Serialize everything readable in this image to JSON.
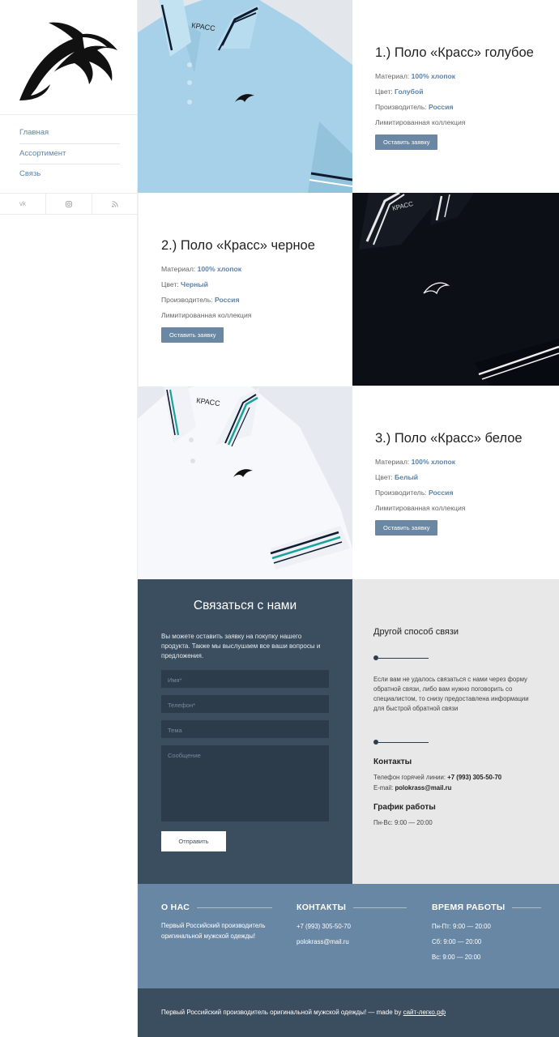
{
  "sidebar": {
    "nav": [
      "Главная",
      "Ассортимент",
      "Связь"
    ],
    "social": [
      "vk-icon",
      "instagram-icon",
      "rss-icon"
    ]
  },
  "products": [
    {
      "title": "1.) Поло «Красс» голубое",
      "material_label": "Материал:",
      "material": "100% хлопок",
      "color_label": "Цвет:",
      "color": "Голубой",
      "maker_label": "Производитель:",
      "maker": "Россия",
      "note": "Лимитированная коллекция",
      "button": "Оставить заявку",
      "shirt_color": "#a9d3ea",
      "collar_tag": "КРАСС"
    },
    {
      "title": "2.) Поло «Красс» черное",
      "material_label": "Материал:",
      "material": "100% хлопок",
      "color_label": "Цвет:",
      "color": "Черный",
      "maker_label": "Производитель:",
      "maker": "Россия",
      "note": "Лимитированная коллекция",
      "button": "Оставить заявку",
      "shirt_color": "#0c0f16",
      "collar_tag": "КРАСС"
    },
    {
      "title": "3.) Поло «Красс» белое",
      "material_label": "Материал:",
      "material": "100% хлопок",
      "color_label": "Цвет:",
      "color": "Белый",
      "maker_label": "Производитель:",
      "maker": "Россия",
      "note": "Лимитированная коллекция",
      "button": "Оставить заявку",
      "shirt_color": "#f5f7fa",
      "collar_tag": "КРАСС"
    }
  ],
  "contact": {
    "title": "Связаться с нами",
    "text": "Вы можете оставить заявку на покупку нашего продукта. Также мы выслушаем все ваши вопросы и предложения.",
    "name_placeholder": "Имя*",
    "phone_placeholder": "Телефон*",
    "subject_placeholder": "Тема",
    "message_placeholder": "Сообщение",
    "send": "Отправить"
  },
  "alt_contact": {
    "title": "Другой способ связи",
    "text": "Если вам не удалось связаться с нами через форму обратной связи, либо вам нужно поговорить со специалистом, то снизу предоставлена информации для быстрой обратной связи",
    "contacts_head": "Контакты",
    "hotline_label": "Телефон горячей линии:",
    "hotline": "+7 (993) 305-50-70",
    "email_label": "E-mail:",
    "email": "polokrass@mail.ru",
    "schedule_head": "График работы",
    "schedule": "Пн-Вс: 9:00 — 20:00"
  },
  "footer": {
    "about_head": "О НАС",
    "about_text": "Первый Российский производитель оригинальной мужской одежды!",
    "contacts_head": "КОНТАКТЫ",
    "phone": "+7 (993) 305-50-70",
    "email": "polokrass@mail.ru",
    "hours_head": "ВРЕМЯ РАБОТЫ",
    "hours": [
      "Пн-Пт: 9:00 — 20:00",
      "Сб: 9:00 — 20:00",
      "Вс: 9:00 — 20:00"
    ],
    "bottom_text": "Первый Российский производитель оригинальной мужской одежды! — made by",
    "bottom_link": "сайт-легко.рф"
  },
  "colors": {
    "accent": "#5d83a8",
    "button": "#6a87a4",
    "dark_panel": "#3a4e5f",
    "footer": "#6787a5"
  }
}
